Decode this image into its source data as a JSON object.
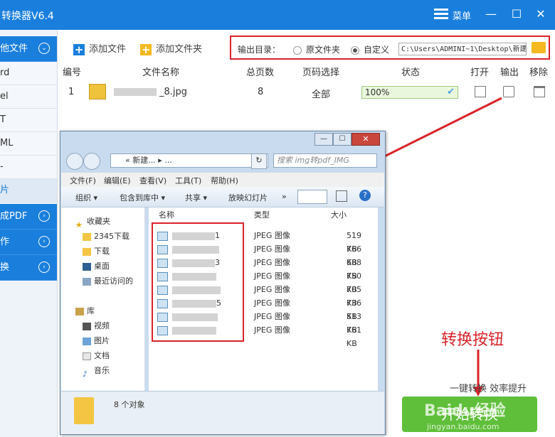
{
  "app": {
    "title": "转换器V6.4",
    "menu_label": "菜单",
    "min": "—",
    "max": "☐",
    "close": "✕"
  },
  "sidebar": {
    "items": [
      {
        "label": "他文件",
        "style": "blue",
        "badge": "⌄"
      },
      {
        "label": "rd",
        "style": "plain"
      },
      {
        "label": "el",
        "style": "plain"
      },
      {
        "label": "T",
        "style": "plain"
      },
      {
        "label": "ML",
        "style": "plain"
      },
      {
        "label": "-",
        "style": "plain"
      },
      {
        "label": "片",
        "style": "sel"
      },
      {
        "label": "成PDF",
        "style": "blue",
        "badge": "›"
      },
      {
        "label": "作",
        "style": "blue",
        "badge": "›"
      },
      {
        "label": "换",
        "style": "blue",
        "badge": "›"
      }
    ]
  },
  "toolbar": {
    "add_file": "添加文件",
    "add_folder": "添加文件夹",
    "output_label": "输出目录：",
    "opt_source": "原文件夹",
    "opt_custom": "自定义",
    "path": "C:\\Users\\ADMINI~1\\Desktop\\新建文"
  },
  "table": {
    "headers": [
      "编号",
      "文件名称",
      "总页数",
      "页码选择",
      "状态",
      "打开",
      "输出",
      "移除"
    ],
    "rows": [
      {
        "num": "1",
        "name": "_8.jpg",
        "pages": "8",
        "range": "全部",
        "status": "100%"
      }
    ]
  },
  "bottom": {
    "annotation": "转换按钮",
    "efficiency": "一键转换 效率提升",
    "start": "开始转换",
    "watermark": "Baidu经验",
    "watermark_url": "jingyan.baidu.com"
  },
  "explorer": {
    "address": "« 新建... ▸ ...",
    "search_placeholder": "搜索 img转pdf_IMG",
    "menu": [
      "文件(F)",
      "编辑(E)",
      "查看(V)",
      "工具(T)",
      "帮助(H)"
    ],
    "commands": [
      "组织 ▾",
      "包含到库中 ▾",
      "共享 ▾",
      "放映幻灯片",
      "»"
    ],
    "nav": [
      {
        "label": "收藏夹",
        "icon": "star-icon"
      },
      {
        "label": "2345下载",
        "icon": "folder-icon"
      },
      {
        "label": "下载",
        "icon": "folder-icon"
      },
      {
        "label": "桌面",
        "icon": "desktop-icon"
      },
      {
        "label": "最近访问的",
        "icon": "recent-icon"
      },
      {
        "label": "库",
        "icon": "library-icon"
      },
      {
        "label": "视频",
        "icon": "video-icon"
      },
      {
        "label": "图片",
        "icon": "picture-icon"
      },
      {
        "label": "文档",
        "icon": "document-icon"
      },
      {
        "label": "音乐",
        "icon": "music-icon"
      }
    ],
    "columns": [
      "名称",
      "类型",
      "大小"
    ],
    "files": [
      {
        "name": "1",
        "type": "JPEG 图像",
        "size": "519 KB"
      },
      {
        "name": "",
        "type": "JPEG 图像",
        "size": "766 KB"
      },
      {
        "name": "3",
        "type": "JPEG 图像",
        "size": "688 KB"
      },
      {
        "name": "",
        "type": "JPEG 图像",
        "size": "750 KB"
      },
      {
        "name": "",
        "type": "JPEG 图像",
        "size": "705 KB"
      },
      {
        "name": "5",
        "type": "JPEG 图像",
        "size": "736 KB"
      },
      {
        "name": "",
        "type": "JPEG 图像",
        "size": "513 KB"
      },
      {
        "name": "",
        "type": "JPEG 图像",
        "size": "761 KB"
      }
    ],
    "status": "8 个对象"
  },
  "colors": {
    "accent": "#1a7fdc",
    "annotation": "#d9232a",
    "start_green": "#5fbf3a"
  }
}
